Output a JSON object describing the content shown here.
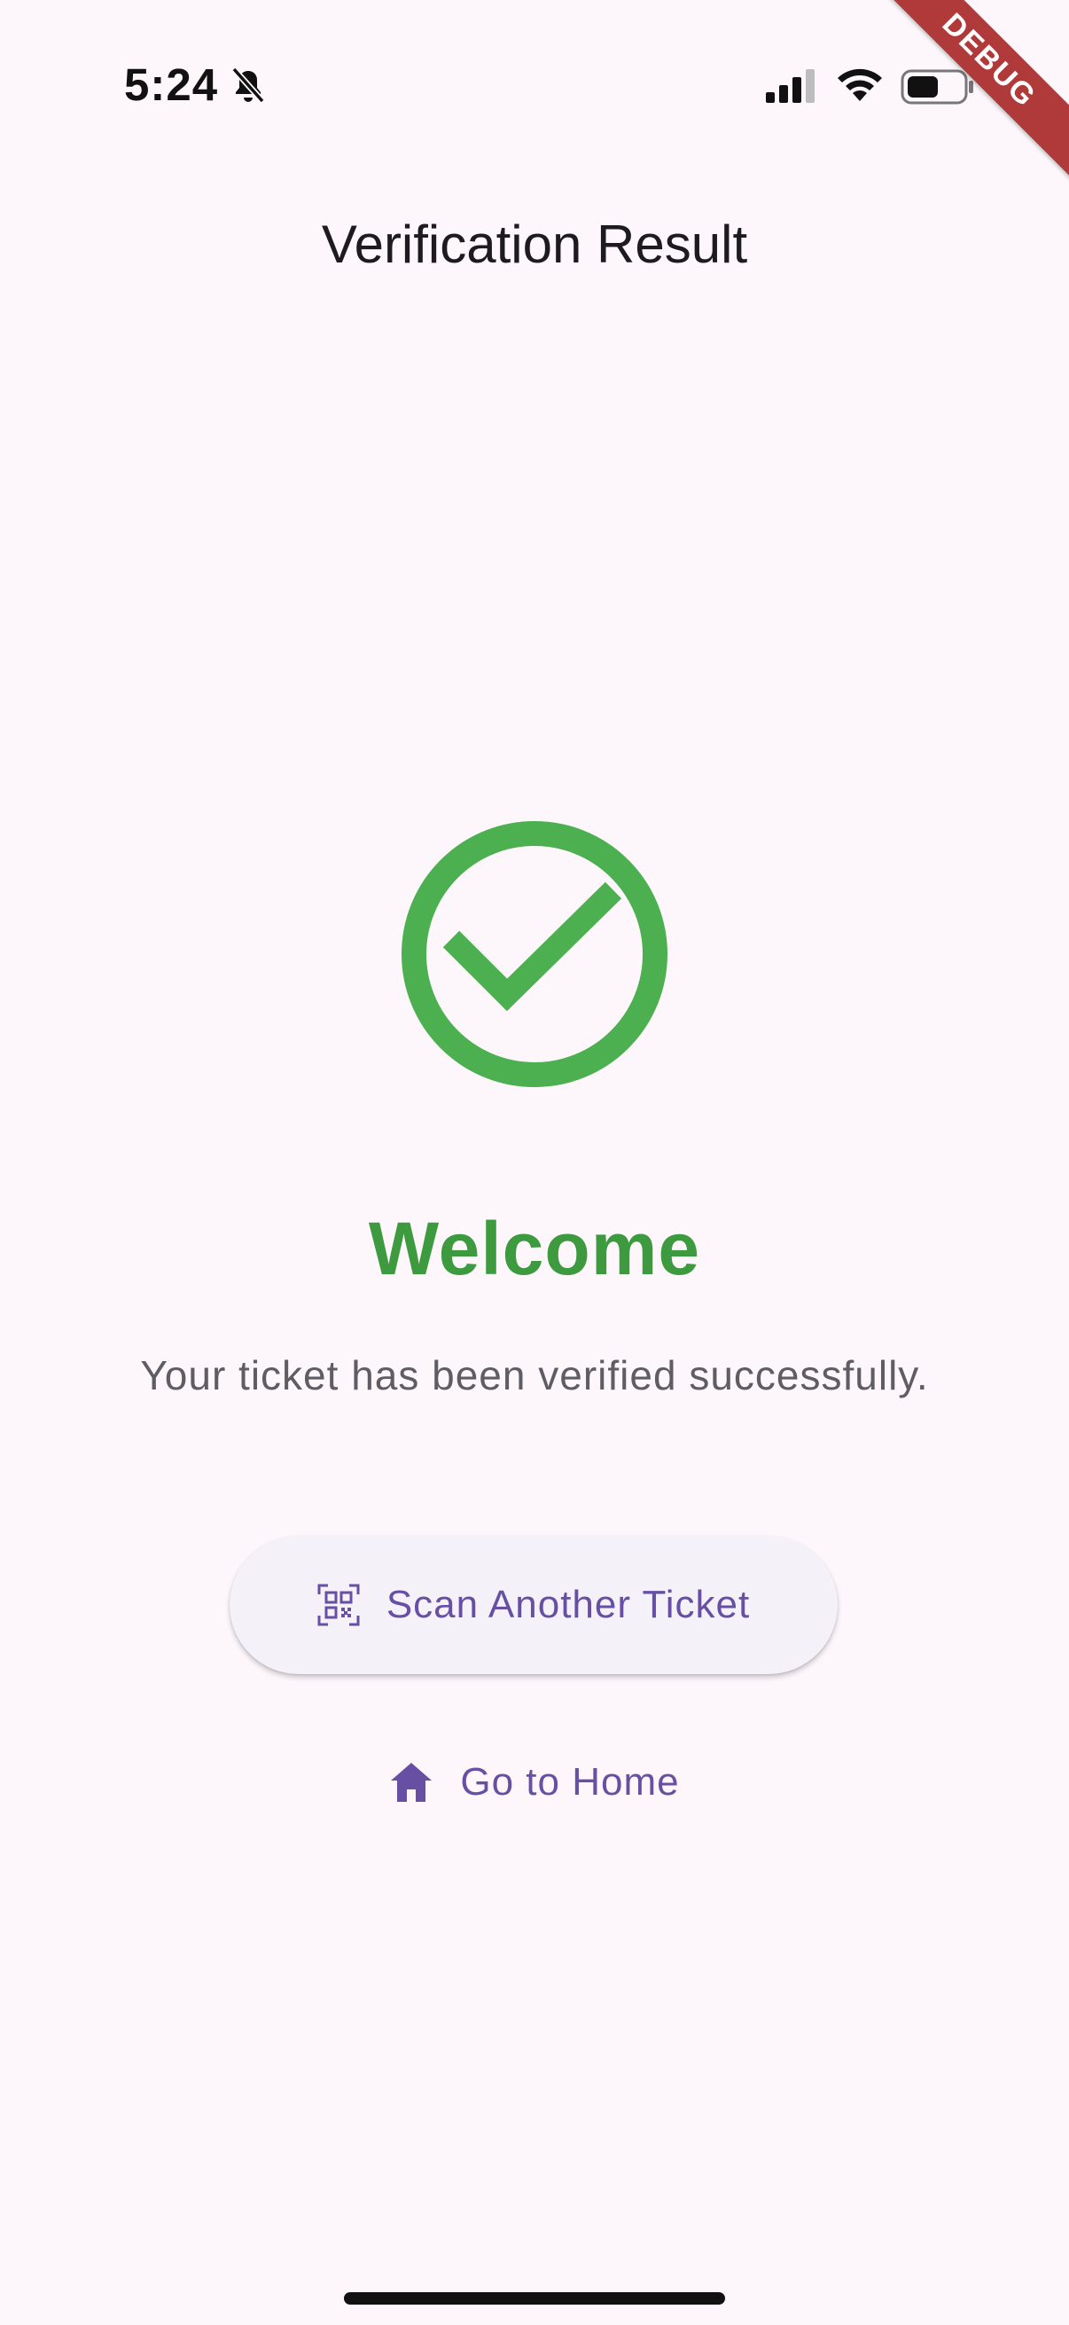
{
  "status_bar": {
    "time": "5:24",
    "bell_icon": "bell-slash-icon",
    "signal_icon": "cellular-signal-icon",
    "wifi_icon": "wifi-icon",
    "battery_icon": "battery-icon"
  },
  "debug_banner": "DEBUG",
  "app_bar": {
    "title": "Verification Result"
  },
  "result": {
    "icon": "check-circle-icon",
    "heading": "Welcome",
    "message": "Your ticket has been verified successfully."
  },
  "actions": {
    "scan_label": "Scan Another Ticket",
    "scan_icon": "qr-code-scanner-icon",
    "home_label": "Go to Home",
    "home_icon": "home-icon"
  },
  "colors": {
    "background": "#fdf7fc",
    "success": "#4caf50",
    "heading": "#3d9a3f",
    "accent": "#6750a4",
    "debug": "#b03a3a"
  }
}
